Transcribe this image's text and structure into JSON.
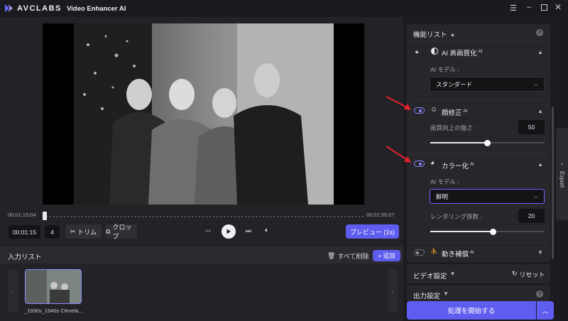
{
  "app": {
    "brand": "AVCLABS",
    "title": "Video Enhancer AI"
  },
  "player": {
    "time_start": "00:01:15:04",
    "time_end": "00:01:55:07",
    "current_time": "00:01:15",
    "frame": "4",
    "trim": "トリム",
    "crop": "クロップ",
    "preview": "プレビュー (1s)",
    "progress": 0.03
  },
  "input_list": {
    "title": "入力リスト",
    "delete_all": "すべて削除",
    "add": "+ 追加",
    "files": [
      {
        "name": "_1930s_1940s Clevela..."
      }
    ]
  },
  "features": {
    "title": "機能リスト",
    "ai_quality": {
      "title": "AI 高画質化",
      "badge": "AI",
      "model_label": "AI モデル :",
      "model_value": "スタンダード"
    },
    "face": {
      "title": "顔修正",
      "badge": "AI",
      "strength_label": "画質向上の強さ :",
      "strength_value": "50",
      "strength": 50
    },
    "colorize": {
      "title": "カラー化",
      "badge": "AI",
      "model_label": "AI モデル :",
      "model_value": "鮮明",
      "render_label": "レンダリング係数 :",
      "render_value": "20",
      "render": 55
    },
    "motion": {
      "title": "動き補償",
      "badge": "AI"
    }
  },
  "video_settings": {
    "title": "ビデオ設定",
    "reset": "リセット"
  },
  "output_settings": {
    "title": "出力設定"
  },
  "start_button": "処理を開始する",
  "export_tab": "Export",
  "colors": {
    "accent": "#5f5cf0",
    "arrow": "#e0222b"
  }
}
